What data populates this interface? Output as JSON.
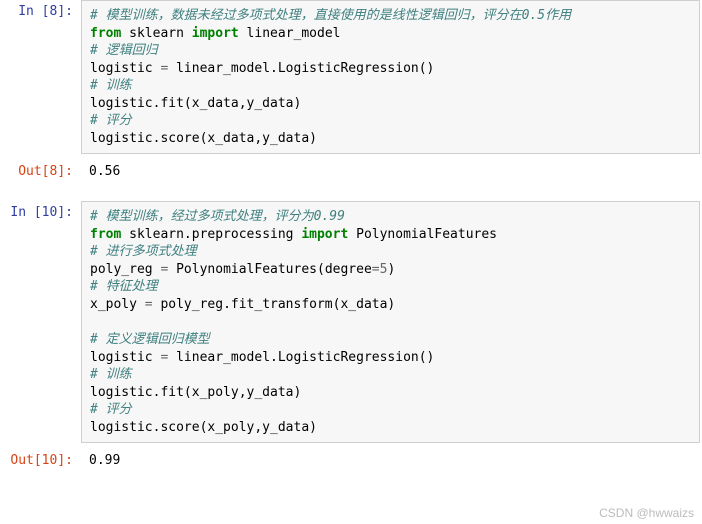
{
  "cells": [
    {
      "type": "in",
      "prompt": "In  [8]:",
      "lines": [
        [
          {
            "cls": "c-comment",
            "t": "# 模型训练，数据未经过多项式处理，直接使用的是线性逻辑回归，评分在0.5作用"
          }
        ],
        [
          {
            "cls": "c-keyword",
            "t": "from"
          },
          {
            "cls": "",
            "t": " sklearn "
          },
          {
            "cls": "c-keyword",
            "t": "import"
          },
          {
            "cls": "",
            "t": " linear_model"
          }
        ],
        [
          {
            "cls": "c-comment",
            "t": "# 逻辑回归"
          }
        ],
        [
          {
            "cls": "",
            "t": "logistic "
          },
          {
            "cls": "c-op",
            "t": "="
          },
          {
            "cls": "",
            "t": " linear_model.LogisticRegression()"
          }
        ],
        [
          {
            "cls": "c-comment",
            "t": "# 训练"
          }
        ],
        [
          {
            "cls": "",
            "t": "logistic.fit(x_data,y_data)"
          }
        ],
        [
          {
            "cls": "c-comment",
            "t": "# 评分"
          }
        ],
        [
          {
            "cls": "",
            "t": "logistic.score(x_data,y_data)"
          }
        ]
      ]
    },
    {
      "type": "out",
      "prompt": "Out[8]:",
      "output": "0.56"
    },
    {
      "type": "in",
      "prompt": "In  [10]:",
      "lines": [
        [
          {
            "cls": "c-comment",
            "t": "# 模型训练，经过多项式处理，评分为0.99"
          }
        ],
        [
          {
            "cls": "c-keyword",
            "t": "from"
          },
          {
            "cls": "",
            "t": " sklearn.preprocessing "
          },
          {
            "cls": "c-keyword",
            "t": "import"
          },
          {
            "cls": "",
            "t": " PolynomialFeatures"
          }
        ],
        [
          {
            "cls": "c-comment",
            "t": "# 进行多项式处理"
          }
        ],
        [
          {
            "cls": "",
            "t": "poly_reg "
          },
          {
            "cls": "c-op",
            "t": "="
          },
          {
            "cls": "",
            "t": " PolynomialFeatures(degree"
          },
          {
            "cls": "c-op",
            "t": "="
          },
          {
            "cls": "c-num",
            "t": "5"
          },
          {
            "cls": "",
            "t": ")"
          }
        ],
        [
          {
            "cls": "c-comment",
            "t": "# 特征处理"
          }
        ],
        [
          {
            "cls": "",
            "t": "x_poly "
          },
          {
            "cls": "c-op",
            "t": "="
          },
          {
            "cls": "",
            "t": " poly_reg.fit_transform(x_data)"
          }
        ],
        [
          {
            "cls": "",
            "t": ""
          }
        ],
        [
          {
            "cls": "c-comment",
            "t": "# 定义逻辑回归模型"
          }
        ],
        [
          {
            "cls": "",
            "t": "logistic "
          },
          {
            "cls": "c-op",
            "t": "="
          },
          {
            "cls": "",
            "t": " linear_model.LogisticRegression()"
          }
        ],
        [
          {
            "cls": "c-comment",
            "t": "# 训练"
          }
        ],
        [
          {
            "cls": "",
            "t": "logistic.fit(x_poly,y_data)"
          }
        ],
        [
          {
            "cls": "c-comment",
            "t": "# 评分"
          }
        ],
        [
          {
            "cls": "",
            "t": "logistic.score(x_poly,y_data)"
          }
        ]
      ]
    },
    {
      "type": "out",
      "prompt": "Out[10]:",
      "output": "0.99"
    }
  ],
  "watermark": "CSDN @hwwaizs"
}
